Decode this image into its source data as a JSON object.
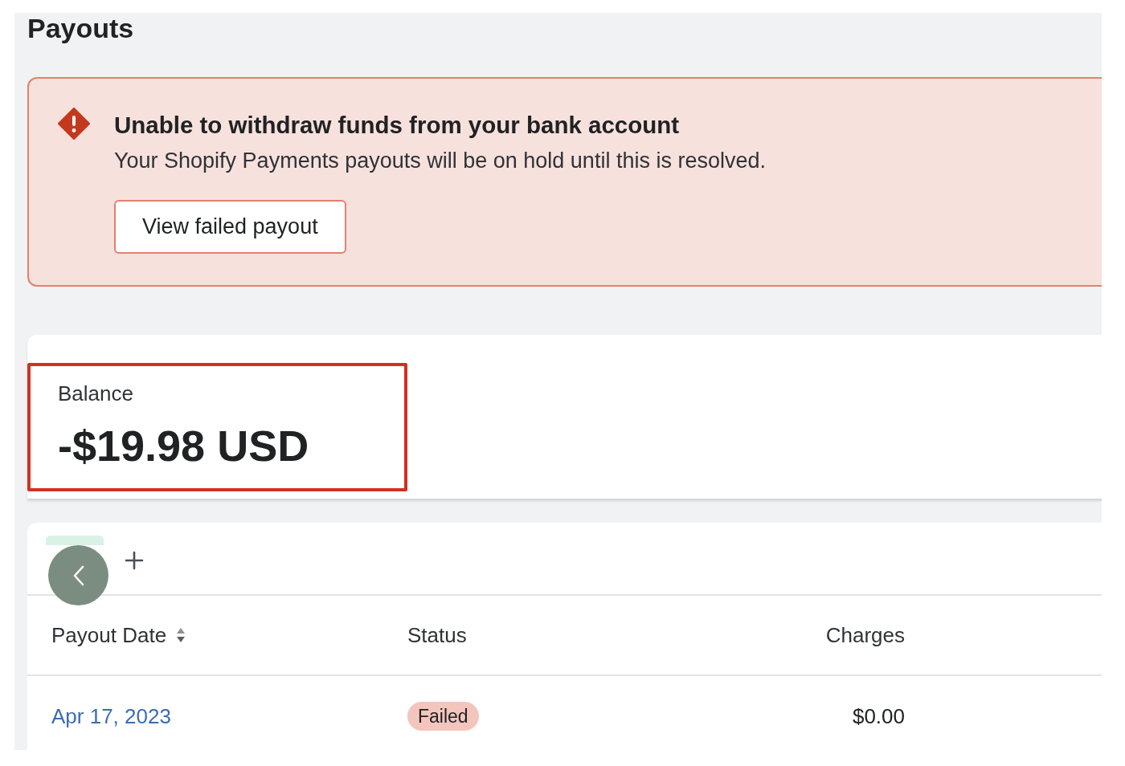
{
  "page": {
    "title": "Payouts"
  },
  "banner": {
    "title": "Unable to withdraw funds from your bank account",
    "message": "Your Shopify Payments payouts will be on hold until this is resolved.",
    "action": "View failed payout"
  },
  "balance": {
    "label": "Balance",
    "amount": "-$19.98 USD",
    "highlighted": true
  },
  "table": {
    "tabs": [
      {
        "selected": true
      }
    ],
    "columns": [
      {
        "label": "Payout Date",
        "sortable": true
      },
      {
        "label": "Status",
        "sortable": false
      },
      {
        "label": "Charges",
        "sortable": false
      }
    ],
    "rows": [
      {
        "payout_date": "Apr 17, 2023",
        "status": "Failed",
        "charges": "$0.00"
      }
    ]
  }
}
